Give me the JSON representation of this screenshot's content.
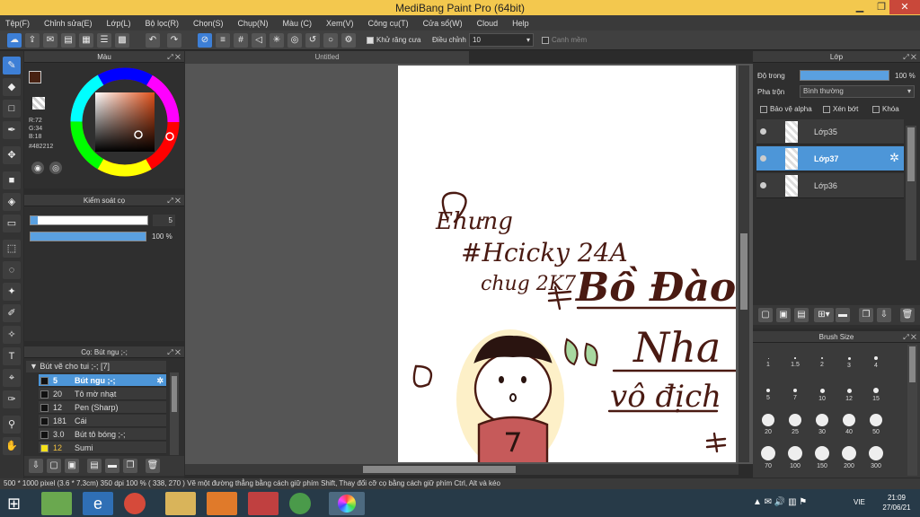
{
  "app": {
    "title": "MediBang Paint Pro (64bit)"
  },
  "menu": [
    "Tệp(F)",
    "Chỉnh sửa(E)",
    "Lớp(L)",
    "Bộ lọc(R)",
    "Chọn(S)",
    "Chụp(N)",
    "Màu (C)",
    "Xem(V)",
    "Công cụ(T)",
    "Cửa sổ(W)",
    "Cloud",
    "Help"
  ],
  "toolbar": {
    "antialias_label": "Khử răng cưa",
    "adjust_label": "Điều chỉnh",
    "adjust_value": "10",
    "edge_label": "Canh mềm"
  },
  "color_panel": {
    "title": "Màu",
    "r": "R:72",
    "g": "G:34",
    "b": "B:18",
    "hex": "#482212",
    "fg": "#482212"
  },
  "brush_control": {
    "title": "Kiểm soát cọ",
    "size": "5",
    "opacity": "100 %",
    "opacity_level": 1.0
  },
  "brush_panel": {
    "title": "Cọ: Bút ngu ;-;",
    "group": "Bút vẽ cho tui ;-; [7]",
    "items": [
      {
        "size": "5",
        "name": "Bút ngu ;-;",
        "swatch": "#111111"
      },
      {
        "size": "20",
        "name": "Tô mờ nhạt",
        "swatch": "#222222"
      },
      {
        "size": "12",
        "name": "Pen (Sharp)",
        "swatch": "#222222"
      },
      {
        "size": "181",
        "name": "Cái",
        "swatch": "#222222"
      },
      {
        "size": "3.0",
        "name": "Bút tô bóng ;-;",
        "swatch": "#222222"
      },
      {
        "size": "12",
        "name": "Sumi",
        "swatch": "#f5e21a"
      }
    ]
  },
  "document": {
    "tab": "Untitled"
  },
  "layer_panel": {
    "title": "Lớp",
    "opacity_label": "Độ trong",
    "opacity": "100 %",
    "opacity_level": 1.0,
    "blend_label": "Pha trộn",
    "blend_value": "Bình thường",
    "protect_alpha": "Bảo vệ alpha",
    "clipping": "Xén bớt",
    "lock": "Khóa",
    "layers": [
      "Lớp35",
      "Lớp37",
      "Lớp36"
    ]
  },
  "brush_size": {
    "title": "Brush Size",
    "rows": [
      [
        "1",
        "1.5",
        "2",
        "3",
        "4"
      ],
      [
        "5",
        "7",
        "10",
        "12",
        "15"
      ],
      [
        "20",
        "25",
        "30",
        "40",
        "50"
      ],
      [
        "70",
        "100",
        "150",
        "200",
        "300"
      ]
    ]
  },
  "status": {
    "text": "500 * 1000 pixel  (3.6 * 7.3cm)   350 dpi   100 %   ( 338, 270 )   Vẽ một đường thẳng bằng cách giữ phím Shift, Thay đổi cỡ cọ bằng cách giữ phím Ctrl, Alt và kéo"
  },
  "taskbar": {
    "lang": "VIE",
    "time": "21:09",
    "date": "27/06/21"
  },
  "canvas_text": {
    "l1": "Ehưng",
    "l2": "#Hcicky 24A",
    "l3": "chug 2K7",
    "l4": "Bồ Đào",
    "l5": "Nha",
    "l6": "vô địch"
  }
}
